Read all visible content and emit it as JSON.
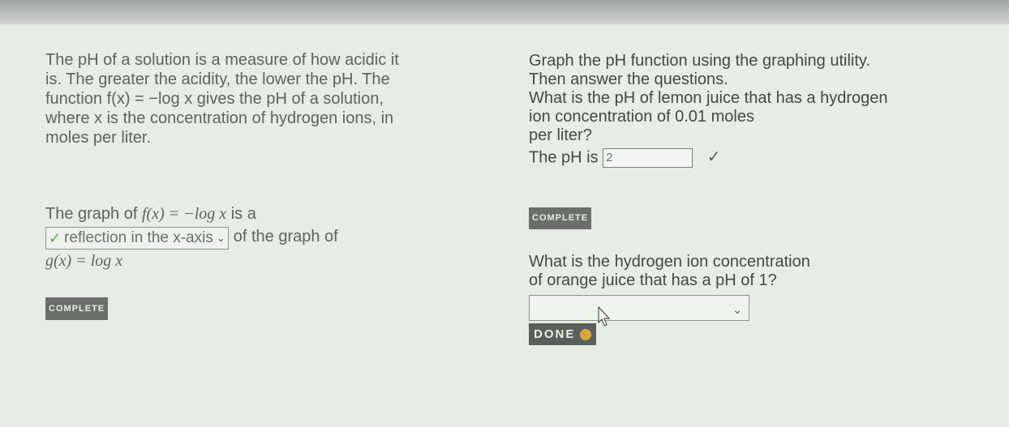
{
  "left": {
    "intro_lines": [
      "The pH of a solution is a measure of how acidic it",
      "is. The greater the acidity, the lower the pH. The",
      "function f(x) = −log x gives the pH of a solution,",
      "where x is the concentration of hydrogen ions, in",
      "moles per liter."
    ],
    "graph_prefix": "The graph of ",
    "graph_func": "f(x) = −log x",
    "graph_suffix": " is a",
    "selected_option": "reflection in the x-axis",
    "after_select": " of the graph of",
    "gx": "g(x) = log x",
    "complete_label": "COMPLETE"
  },
  "right": {
    "intro_lines": [
      "Graph the pH function using the graphing utility.",
      "Then answer the questions."
    ],
    "q1_lines": [
      "What is the pH of lemon juice that has a hydrogen",
      "ion concentration of 0.01 moles",
      "per liter?"
    ],
    "ph_prefix": "The pH is ",
    "ph_value": "2",
    "complete_label": "COMPLETE",
    "q2_lines": [
      "What is the hydrogen ion concentration",
      "of orange juice that has a pH of 1?"
    ],
    "done_label": "DONE"
  },
  "icons": {
    "check": "✓",
    "chevron": "⌄"
  },
  "colors": {
    "background": "#e8ece7",
    "badge": "#6b6e6b",
    "done_button": "#5b5f5b"
  }
}
